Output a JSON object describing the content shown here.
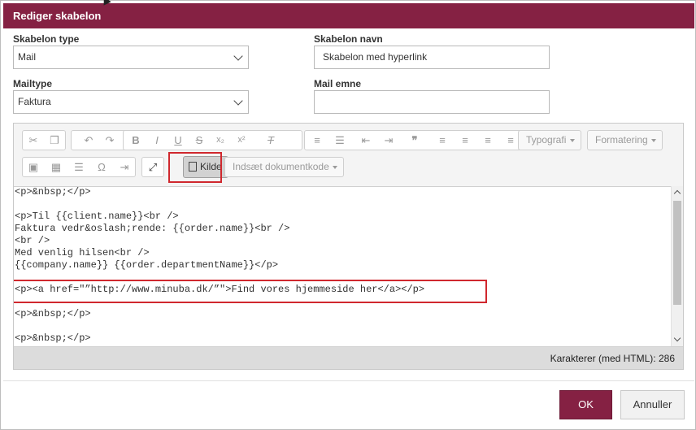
{
  "dialog": {
    "title": "Rediger skabelon"
  },
  "form": {
    "template_type_label": "Skabelon type",
    "template_type_value": "Mail",
    "template_name_label": "Skabelon navn",
    "template_name_value": "Skabelon med hyperlink",
    "mailtype_label": "Mailtype",
    "mailtype_value": "Faktura",
    "mail_subject_label": "Mail emne",
    "mail_subject_value": ""
  },
  "toolbar": {
    "icons": [
      "cut-icon",
      "copy-icon",
      "undo-icon",
      "redo-icon",
      "bold-icon",
      "italic-icon",
      "underline-icon",
      "strikethrough-icon",
      "subscript-icon",
      "superscript-icon",
      "remove-format-icon",
      "numbered-list-icon",
      "bulleted-list-icon",
      "decrease-indent-icon",
      "increase-indent-icon",
      "blockquote-icon",
      "align-left-icon",
      "align-center-icon",
      "align-right-icon",
      "justify-icon",
      "image-icon",
      "table-icon",
      "horizontal-line-icon",
      "special-char-icon",
      "page-break-icon",
      "maximize-icon",
      "source-icon"
    ],
    "typography_label": "Typografi",
    "formatting_label": "Formatering",
    "source_label": "Kilde",
    "insert_doc_code_label": "Indsæt dokumentkode"
  },
  "editor": {
    "lines": [
      "<p>&nbsp;</p>",
      "",
      "<p>Til {{client.name}}<br />",
      "Faktura vedr&oslash;rende: {{order.name}}<br />",
      "<br />",
      "Med venlig hilsen<br />",
      "{{company.name}} {{order.departmentName}}</p>",
      "",
      "<p><a href=\"”http://www.minuba.dk/”\">Find vores hjemmeside her</a></p>",
      "",
      "<p>&nbsp;</p>",
      "",
      "<p>&nbsp;</p>"
    ],
    "status": "Karakterer (med HTML): 286"
  },
  "footer": {
    "ok_label": "OK",
    "cancel_label": "Annuller"
  },
  "colors": {
    "accent": "#852143",
    "highlight": "#d0282e"
  }
}
